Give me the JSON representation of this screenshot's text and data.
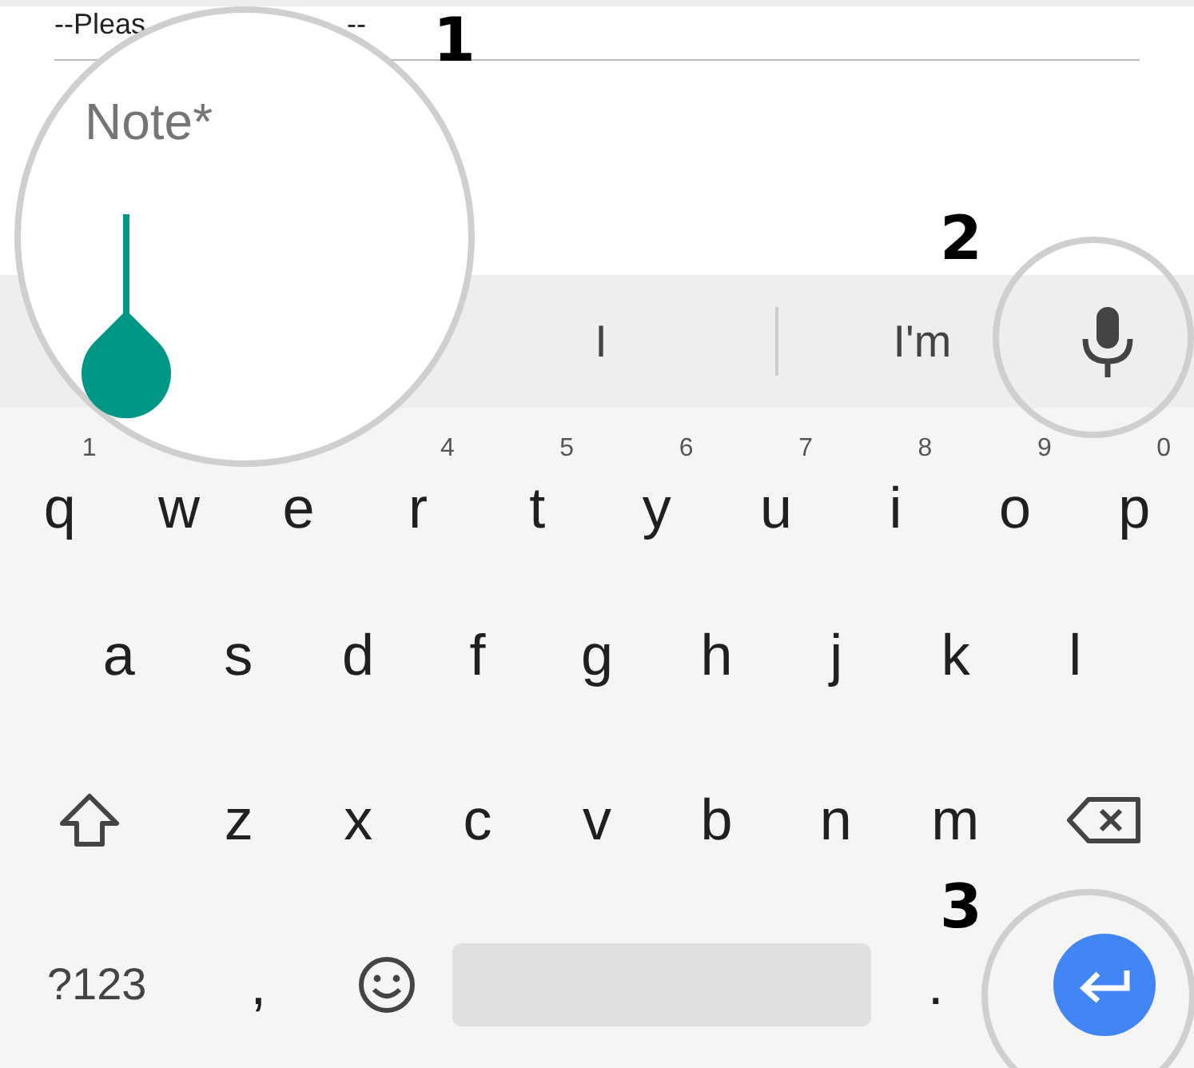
{
  "select_field": {
    "value_start": "--Pleas",
    "value_end": "--"
  },
  "note_field": {
    "label": "Note*"
  },
  "suggestions": [
    "I",
    "I'm"
  ],
  "rows": [
    [
      {
        "kind": "letter",
        "label": "q",
        "hint": "1"
      },
      {
        "kind": "letter",
        "label": "w"
      },
      {
        "kind": "letter",
        "label": "e"
      },
      {
        "kind": "letter",
        "label": "r",
        "hint": "4"
      },
      {
        "kind": "letter",
        "label": "t",
        "hint": "5"
      },
      {
        "kind": "letter",
        "label": "y",
        "hint": "6"
      },
      {
        "kind": "letter",
        "label": "u",
        "hint": "7"
      },
      {
        "kind": "letter",
        "label": "i",
        "hint": "8"
      },
      {
        "kind": "letter",
        "label": "o",
        "hint": "9"
      },
      {
        "kind": "letter",
        "label": "p",
        "hint": "0"
      }
    ],
    [
      {
        "kind": "letter",
        "label": "a"
      },
      {
        "kind": "letter",
        "label": "s"
      },
      {
        "kind": "letter",
        "label": "d"
      },
      {
        "kind": "letter",
        "label": "f"
      },
      {
        "kind": "letter",
        "label": "g"
      },
      {
        "kind": "letter",
        "label": "h"
      },
      {
        "kind": "letter",
        "label": "j"
      },
      {
        "kind": "letter",
        "label": "k"
      },
      {
        "kind": "letter",
        "label": "l"
      }
    ],
    [
      {
        "kind": "shift"
      },
      {
        "kind": "letter",
        "label": "z"
      },
      {
        "kind": "letter",
        "label": "x"
      },
      {
        "kind": "letter",
        "label": "c"
      },
      {
        "kind": "letter",
        "label": "v"
      },
      {
        "kind": "letter",
        "label": "b"
      },
      {
        "kind": "letter",
        "label": "n"
      },
      {
        "kind": "letter",
        "label": "m"
      },
      {
        "kind": "backspace"
      }
    ],
    [
      {
        "kind": "symbols",
        "label": "?123"
      },
      {
        "kind": "letter",
        "label": ","
      },
      {
        "kind": "emoji"
      },
      {
        "kind": "space"
      },
      {
        "kind": "letter",
        "label": "."
      },
      {
        "kind": "enter"
      }
    ]
  ],
  "annotations": [
    "1",
    "2",
    "3"
  ]
}
